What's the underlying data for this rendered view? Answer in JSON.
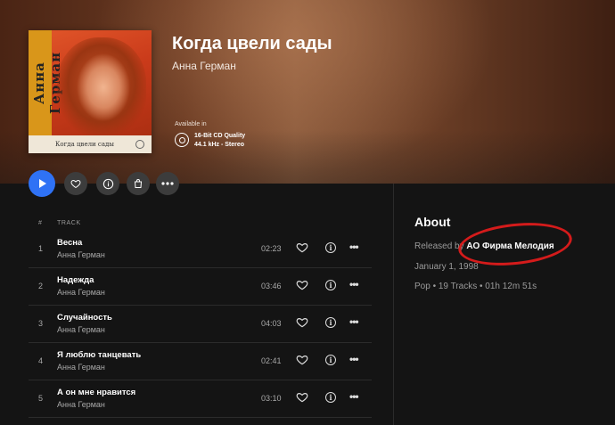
{
  "album": {
    "title": "Когда цвели сады",
    "artist": "Анна Герман",
    "available_in_label": "Available in",
    "quality_line1": "16-Bit CD Quality",
    "quality_line2": "44.1 kHz - Stereo",
    "cover": {
      "vertical_text": "Анна Герман",
      "bottom_text": "Когда цвели сады"
    }
  },
  "actions": {
    "play_icon": "play-icon",
    "favorite_icon": "heart-icon",
    "info_icon": "info-icon",
    "buy_icon": "shopping-bag-icon",
    "more_icon": "more-icon"
  },
  "tracklist": {
    "header_num": "#",
    "header_track": "TRACK",
    "tracks": [
      {
        "num": "1",
        "title": "Весна",
        "artist": "Анна Герман",
        "duration": "02:23"
      },
      {
        "num": "2",
        "title": "Надежда",
        "artist": "Анна Герман",
        "duration": "03:46"
      },
      {
        "num": "3",
        "title": "Случайность",
        "artist": "Анна Герман",
        "duration": "04:03"
      },
      {
        "num": "4",
        "title": "Я люблю танцевать",
        "artist": "Анна Герман",
        "duration": "02:41"
      },
      {
        "num": "5",
        "title": "А он мне нравится",
        "artist": "Анна Герман",
        "duration": "03:10"
      }
    ]
  },
  "about": {
    "title": "About",
    "released_by_prefix": "Released by",
    "label": "АО Фирма Мелодия",
    "date": "January 1, 1998",
    "summary": "Pop • 19 Tracks • 01h 12m 51s"
  },
  "colors": {
    "accent": "#2f72f5",
    "annotation": "#d41b1b",
    "background": "#141414"
  }
}
